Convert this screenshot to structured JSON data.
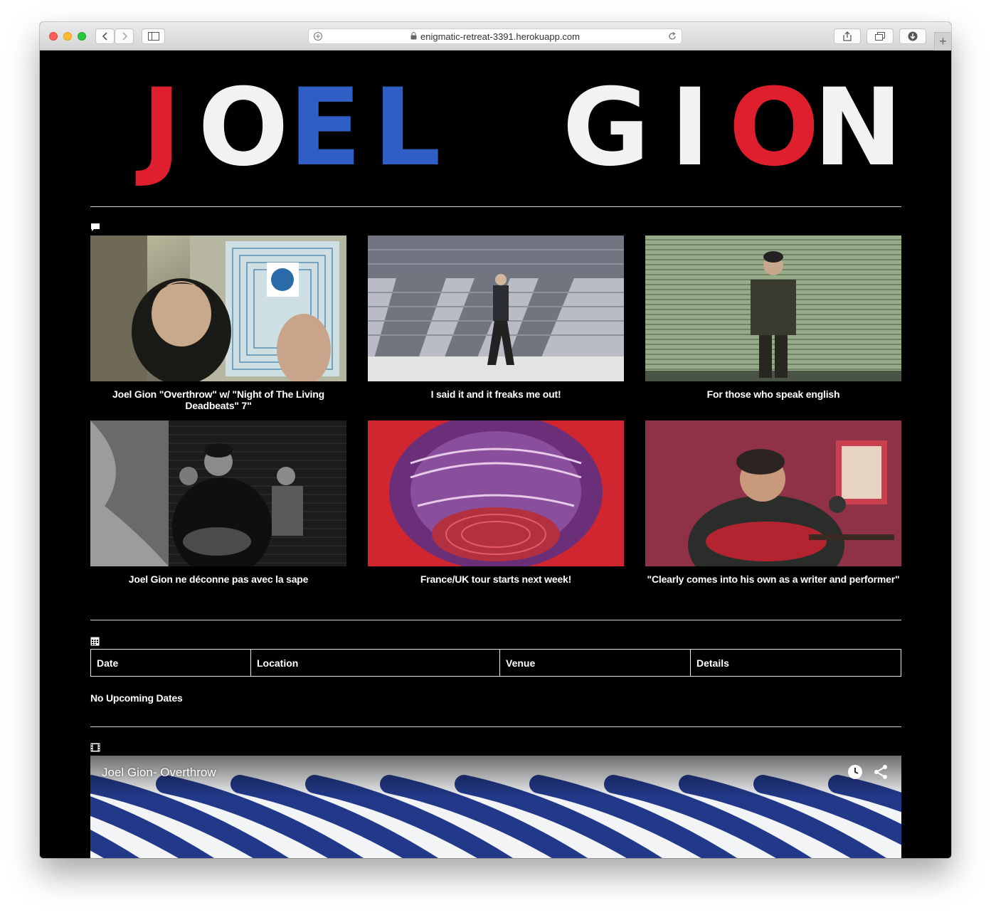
{
  "browser": {
    "url": "enigmatic-retreat-3391.herokuapp.com",
    "icons": [
      "back-icon",
      "forward-icon",
      "sidebar-icon",
      "plus-circle-icon",
      "lock-icon",
      "reload-icon",
      "share-icon",
      "tabs-icon",
      "download-icon",
      "new-tab-icon"
    ]
  },
  "banner": {
    "letters_first": [
      {
        "ch": "J",
        "color": "#e01f2e"
      },
      {
        "ch": "O",
        "color": "#f2f2f2"
      },
      {
        "ch": "E",
        "color": "#2f5fc4"
      },
      {
        "ch": "L",
        "color": "#2f5fc4"
      }
    ],
    "letters_second": [
      {
        "ch": "G",
        "color": "#f2f2f2"
      },
      {
        "ch": "I",
        "color": "#f2f2f2"
      },
      {
        "ch": "O",
        "color": "#e01f2e"
      },
      {
        "ch": "N",
        "color": "#f2f2f2"
      }
    ],
    "alt": "JOEL GION"
  },
  "news": {
    "icon": "comment-icon",
    "items": [
      {
        "caption": "Joel Gion \"Overthrow\" w/ \"Night of The Living Deadbeats\" 7\""
      },
      {
        "caption": "I said it and it freaks me out!"
      },
      {
        "caption": "For those who speak english"
      },
      {
        "caption": "Joel Gion ne déconne pas avec la sape"
      },
      {
        "caption": "France/UK tour starts next week!"
      },
      {
        "caption": "\"Clearly comes into his own as a writer and performer\""
      }
    ]
  },
  "shows": {
    "icon": "calendar-icon",
    "headers": [
      "Date",
      "Location",
      "Venue",
      "Details"
    ],
    "empty_text": "No Upcoming Dates"
  },
  "videos": {
    "icon": "film-icon",
    "title": "Joel Gion- Overthrow",
    "icons": [
      "watch-later-icon",
      "share-icon"
    ]
  }
}
